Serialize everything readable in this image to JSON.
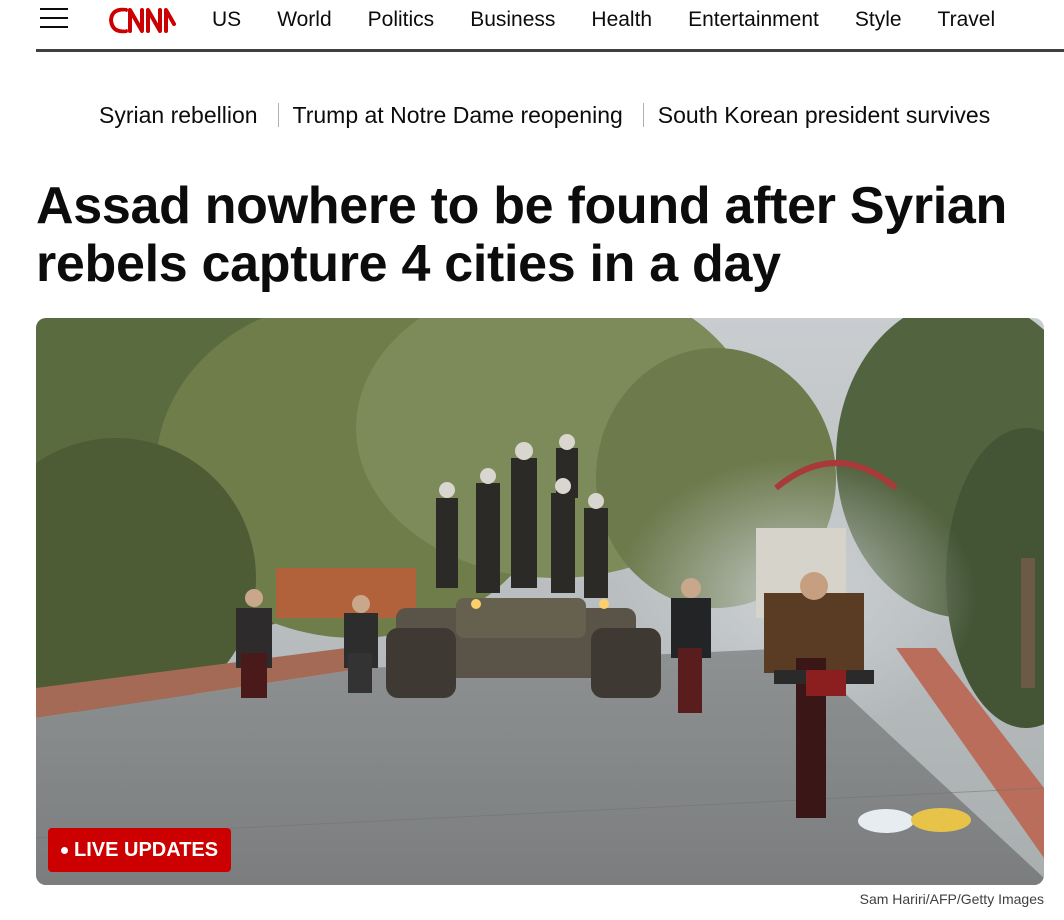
{
  "brand": {
    "name": "CNN",
    "color": "#cc0000"
  },
  "header": {
    "menu_icon": "hamburger-menu-icon",
    "nav": [
      "US",
      "World",
      "Politics",
      "Business",
      "Health",
      "Entertainment",
      "Style",
      "Travel"
    ]
  },
  "trending": [
    "Syrian rebellion",
    "Trump at Notre Dame reopening",
    "South Korean president survives"
  ],
  "article": {
    "headline": "Assad nowhere to be found after Syrian rebels capture 4 cities in a day",
    "live_label": "LIVE UPDATES",
    "photo_credit": "Sam Hariri/AFP/Getty Images"
  }
}
